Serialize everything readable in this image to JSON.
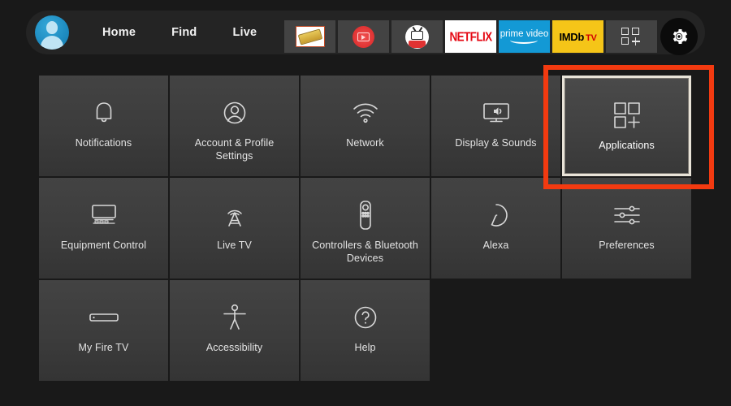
{
  "nav": {
    "avatar_label": "profile-avatar",
    "links": [
      {
        "label": "Home"
      },
      {
        "label": "Find"
      },
      {
        "label": "Live"
      }
    ],
    "apps": [
      {
        "name": "cinema-ticket-app",
        "label": ""
      },
      {
        "name": "red-tv-app",
        "label": ""
      },
      {
        "name": "white-tv-app",
        "label": ""
      },
      {
        "name": "netflix",
        "label": "NETFLIX"
      },
      {
        "name": "prime-video",
        "label": "prime video"
      },
      {
        "name": "imdb-tv",
        "label": "IMDb"
      },
      {
        "name": "imdb-tv-suffix",
        "label": "TV"
      }
    ],
    "app_grid_label": "app-library",
    "settings_label": "settings-gear"
  },
  "grid": {
    "tiles": [
      {
        "label": "Notifications",
        "icon": "bell-icon"
      },
      {
        "label": "Account & Profile Settings",
        "icon": "person-circle-icon"
      },
      {
        "label": "Network",
        "icon": "wifi-icon"
      },
      {
        "label": "Display & Sounds",
        "icon": "display-sound-icon"
      },
      {
        "label": "Applications",
        "icon": "grid-plus-icon"
      },
      {
        "label": "Equipment Control",
        "icon": "tv-stand-icon"
      },
      {
        "label": "Live TV",
        "icon": "broadcast-tower-icon"
      },
      {
        "label": "Controllers & Bluetooth Devices",
        "icon": "remote-control-icon"
      },
      {
        "label": "Alexa",
        "icon": "alexa-ring-icon"
      },
      {
        "label": "Preferences",
        "icon": "sliders-icon"
      },
      {
        "label": "My Fire TV",
        "icon": "fire-tv-stick-icon"
      },
      {
        "label": "Accessibility",
        "icon": "accessibility-person-icon"
      },
      {
        "label": "Help",
        "icon": "question-circle-icon"
      }
    ],
    "highlighted_index": 4,
    "highlight_color": "#f33a10"
  },
  "colors": {
    "page_background": "#191919",
    "tile_background": "#3c3c3c",
    "netflix_red": "#e50914",
    "prime_blue": "#1399d5",
    "imdb_yellow": "#f5c518",
    "avatar_blue": "#1f8dc2"
  }
}
